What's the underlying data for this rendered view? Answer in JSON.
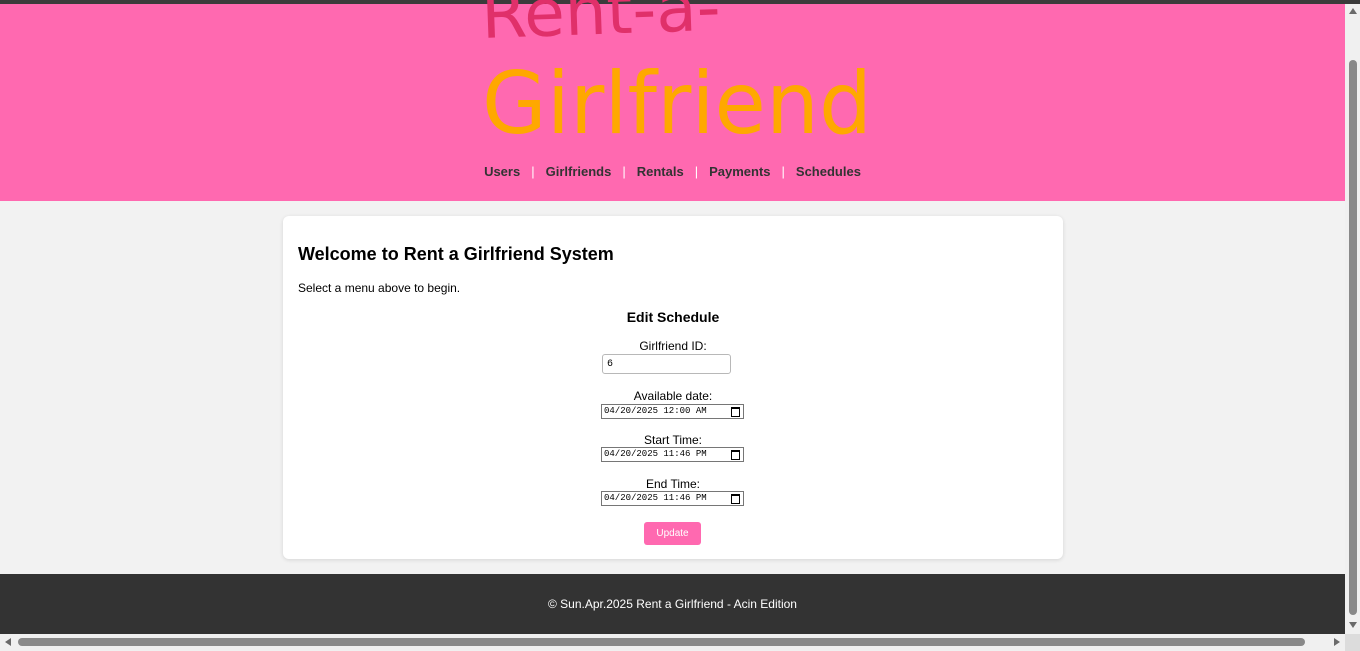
{
  "logo": {
    "line1": "Rent-a-",
    "line2": "Girlfriend",
    "colors": {
      "rent": "#e0306a",
      "girlfriend": "#ffa800"
    }
  },
  "nav": {
    "items": [
      {
        "label": "Users"
      },
      {
        "label": "Girlfriends"
      },
      {
        "label": "Rentals"
      },
      {
        "label": "Payments"
      },
      {
        "label": "Schedules"
      }
    ],
    "separator": "|"
  },
  "main": {
    "title": "Welcome to Rent a Girlfriend System",
    "intro": "Select a menu above to begin.",
    "form": {
      "title": "Edit Schedule",
      "girlfriend_id_label": "Girlfriend ID:",
      "girlfriend_id_value": "6",
      "available_date_label": "Available date:",
      "available_date_value": "04/20/2025 12:00 AM",
      "start_time_label": "Start Time:",
      "start_time_value": "04/20/2025 11:46 PM",
      "end_time_label": "End Time:",
      "end_time_value": "04/20/2025 11:46 PM",
      "submit_label": "Update"
    }
  },
  "footer": {
    "text": "© Sun.Apr.2025 Rent a Girlfriend - Acin Edition"
  },
  "colors": {
    "header_bg": "#ff69b0",
    "footer_bg": "#333333",
    "accent": "#ff69b0"
  }
}
